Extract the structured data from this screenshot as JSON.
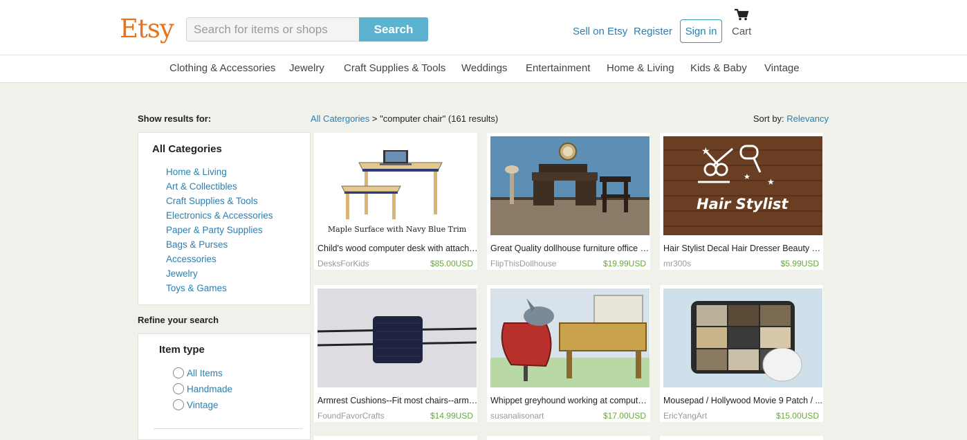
{
  "header": {
    "logo": "Etsy",
    "search_placeholder": "Search for items or shops",
    "search_button": "Search",
    "sell_link": "Sell on Etsy",
    "register_link": "Register",
    "signin_button": "Sign in",
    "cart_label": "Cart",
    "cart_icon": "shopping-cart-icon"
  },
  "nav": {
    "items": [
      "Clothing & Accessories",
      "Jewelry",
      "Craft Supplies & Tools",
      "Weddings",
      "Entertainment",
      "Home & Living",
      "Kids & Baby",
      "Vintage"
    ]
  },
  "sidebar": {
    "show_results_title": "Show results for:",
    "all_categories": "All Categories",
    "categories": [
      "Home & Living",
      "Art & Collectibles",
      "Craft Supplies & Tools",
      "Electronics & Accessories",
      "Paper & Party Supplies",
      "Bags & Purses",
      "Accessories",
      "Jewelry",
      "Toys & Games"
    ],
    "refine_title": "Refine your search",
    "item_type_title": "Item type",
    "item_type_options": [
      "All Items",
      "Handmade",
      "Vintage"
    ]
  },
  "main": {
    "breadcrumb_link": "All Catergories",
    "breadcrumb_sep": " > ",
    "breadcrumb_query": "\"computer chair\" (161 results)",
    "sort_label": "Sort by: ",
    "sort_value": "Relevancy"
  },
  "listings": [
    {
      "title": "Child's wood computer desk with attache...",
      "shop": "DesksForKids",
      "price": "$85.00USD",
      "image_caption": "Maple Surface with Navy Blue Trim"
    },
    {
      "title": "Great Quality dollhouse furniture office s...",
      "shop": "FlipThisDollhouse",
      "price": "$19.99USD"
    },
    {
      "title": "Hair Stylist Decal Hair Dresser Beauty S...",
      "shop": "mr300s",
      "price": "$5.99USD",
      "image_caption": "Hair Stylist"
    },
    {
      "title": "Armrest Cushions--Fit most chairs--arm r...",
      "shop": "FoundFavorCrafts",
      "price": "$14.99USD"
    },
    {
      "title": "Whippet greyhound working at computer...",
      "shop": "susanalisonart",
      "price": "$17.00USD"
    },
    {
      "title": "Mousepad / Hollywood Movie 9 Patch / ...",
      "shop": "EricYangArt",
      "price": "$15.00USD"
    }
  ],
  "colors": {
    "brand_orange": "#e8731b",
    "link_blue": "#2a7fb0",
    "search_button": "#5bb3cf",
    "price_green": "#6aa83a",
    "page_bg": "#f1f1eb"
  }
}
